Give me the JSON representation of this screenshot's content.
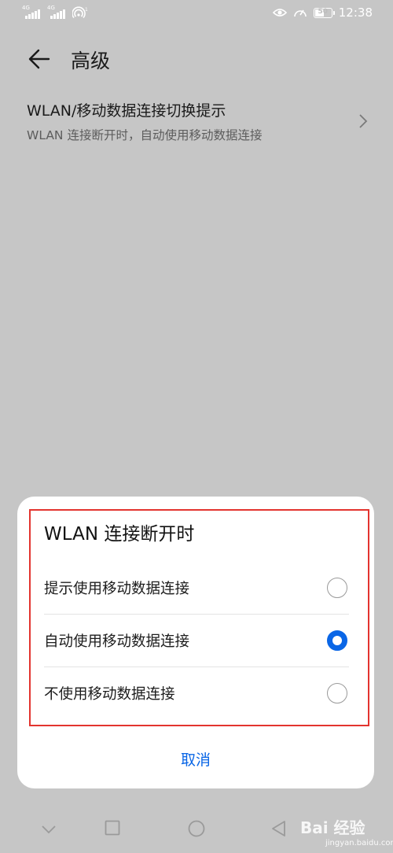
{
  "status_bar": {
    "time": "12:38",
    "battery_level": "50",
    "signal_label_1": "4G",
    "signal_label_2": "4G",
    "wifi_badge": "1"
  },
  "header": {
    "title": "高级"
  },
  "setting_item": {
    "title": "WLAN/移动数据连接切换提示",
    "subtitle": "WLAN 连接断开时，自动使用移动数据连接"
  },
  "dialog": {
    "title": "WLAN 连接断开时",
    "options": [
      {
        "label": "提示使用移动数据连接",
        "selected": false
      },
      {
        "label": "自动使用移动数据连接",
        "selected": true
      },
      {
        "label": "不使用移动数据连接",
        "selected": false
      }
    ],
    "cancel_label": "取消",
    "accent_color": "#0a66e6",
    "highlight_color": "#e3342f"
  },
  "watermark": {
    "text": "Bai 经验",
    "sub": "jingyan.baidu.com"
  }
}
